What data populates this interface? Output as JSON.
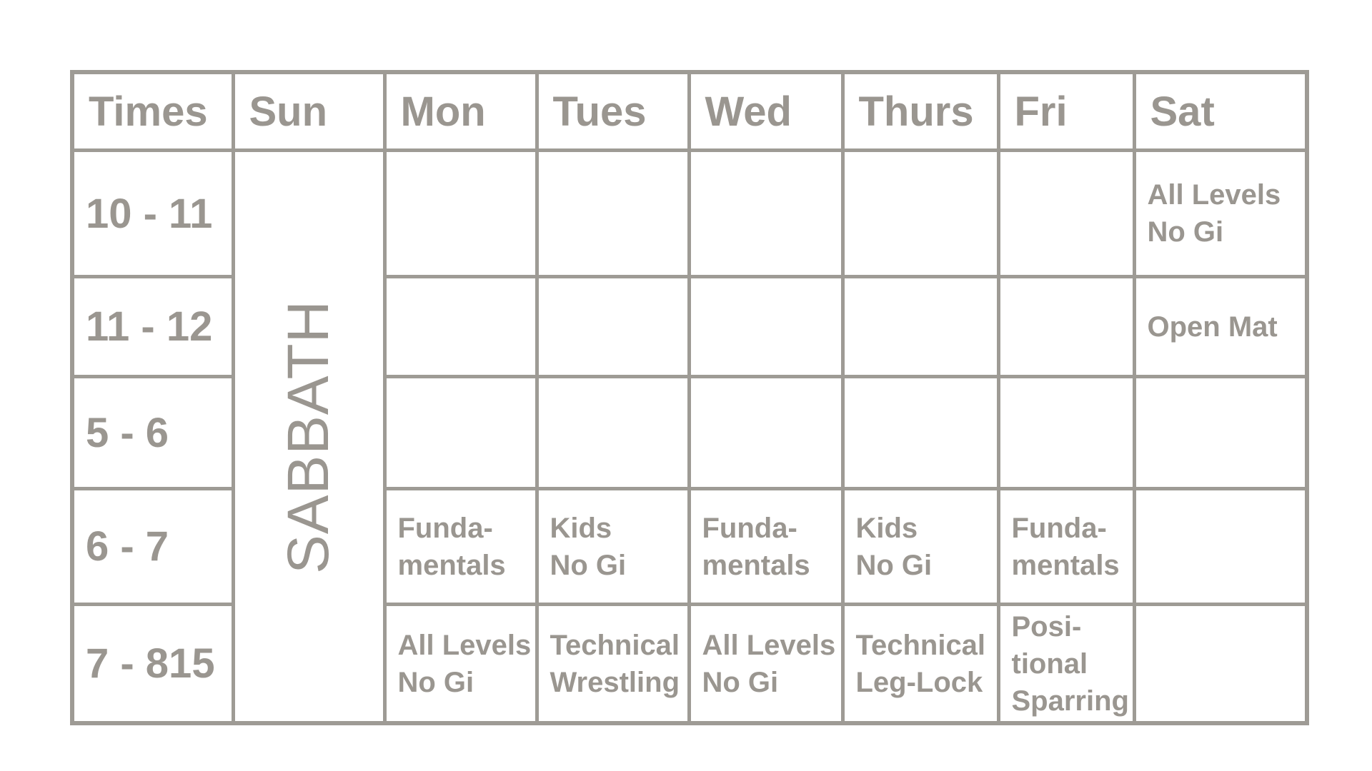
{
  "headers": [
    "Times",
    "Sun",
    "Mon",
    "Tues",
    "Wed",
    "Thurs",
    "Fri",
    "Sat"
  ],
  "sunday_note": "SABBATH",
  "rows": [
    {
      "time": "10 - 11",
      "cells": [
        [],
        [],
        [],
        [],
        [],
        [
          "All Levels",
          "No Gi"
        ]
      ]
    },
    {
      "time": "11 - 12",
      "cells": [
        [],
        [],
        [],
        [],
        [],
        [
          "Open Mat"
        ]
      ]
    },
    {
      "time": "5 - 6",
      "cells": [
        [],
        [],
        [],
        [],
        [],
        []
      ]
    },
    {
      "time": "6 - 7",
      "cells": [
        [
          "Funda-",
          "mentals"
        ],
        [
          "Kids",
          "No Gi"
        ],
        [
          "Funda-",
          "mentals"
        ],
        [
          "Kids",
          "No Gi"
        ],
        [
          "Funda-",
          "mentals"
        ],
        []
      ]
    },
    {
      "time": "7 - 815",
      "cells": [
        [
          "All Levels",
          "No Gi"
        ],
        [
          "Technical",
          "Wrestling"
        ],
        [
          "All Levels",
          "No Gi"
        ],
        [
          "Technical",
          "Leg-Lock"
        ],
        [
          "Posi-",
          "tional",
          "Sparring"
        ],
        []
      ]
    }
  ],
  "colors": {
    "grid": "#9e9b95",
    "text": "#9a9690",
    "background": "#ffffff"
  }
}
